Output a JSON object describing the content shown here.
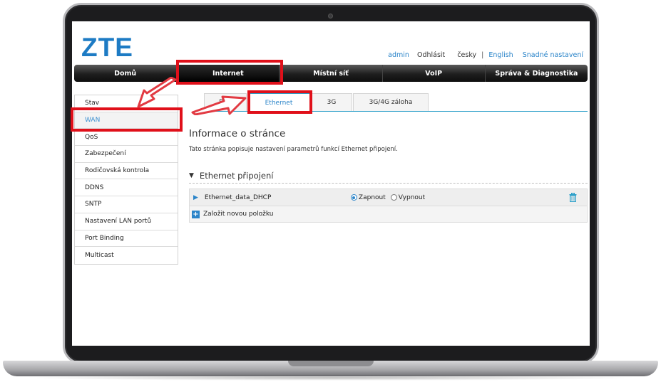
{
  "brand": {
    "logo": "ZTE"
  },
  "header": {
    "user": "admin",
    "logout": "Odhlásit",
    "lang_current": "česky",
    "lang_separator": "|",
    "lang_other": "English",
    "easy_setup": "Snadné nastavení"
  },
  "nav": {
    "items": [
      {
        "label": "Domů"
      },
      {
        "label": "Internet",
        "active": true
      },
      {
        "label": "Místní síť"
      },
      {
        "label": "VoIP"
      },
      {
        "label": "Správa & Diagnostika"
      }
    ]
  },
  "sidebar": {
    "items": [
      {
        "label": "Stav"
      },
      {
        "label": "WAN",
        "active": true
      },
      {
        "label": "QoS"
      },
      {
        "label": "Zabezpečení"
      },
      {
        "label": "Rodičovská kontrola"
      },
      {
        "label": "DDNS"
      },
      {
        "label": "SNTP"
      },
      {
        "label": "Nastavení LAN portů"
      },
      {
        "label": "Port Binding"
      },
      {
        "label": "Multicast"
      }
    ]
  },
  "tabs": {
    "items": [
      {
        "label": "DSL"
      },
      {
        "label": "Ethernet",
        "active": true
      },
      {
        "label": "3G"
      },
      {
        "label": "3G/4G záloha"
      }
    ]
  },
  "main": {
    "info_title": "Informace o stránce",
    "info_desc": "Tato stránka popisuje nastavení parametrů funkcí Ethernet připojení.",
    "section_title": "Ethernet připojení",
    "entry": {
      "name": "Ethernet_data_DHCP",
      "radio_on": "Zapnout",
      "radio_off": "Vypnout",
      "selected": "Zapnout"
    },
    "add_label": "Založit novou položku"
  },
  "colors": {
    "accent": "#2a84c9",
    "logo": "#1d7bc4",
    "annotation": "#e0101a"
  },
  "icons": {
    "expand": "triangle-down-icon",
    "row": "play-icon",
    "delete": "trash-icon",
    "add": "plus-icon"
  }
}
